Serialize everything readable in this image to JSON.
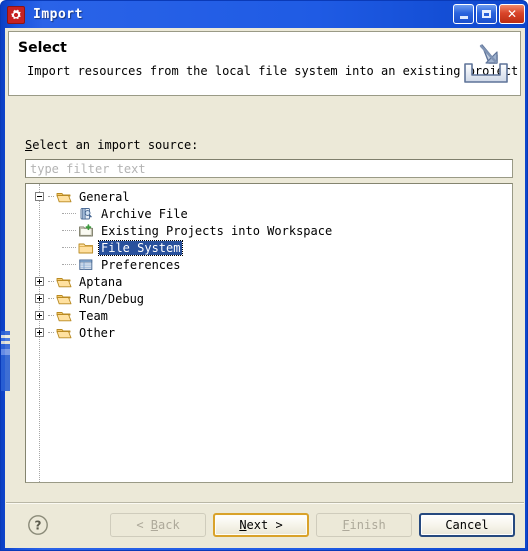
{
  "window": {
    "title": "Import",
    "icon": "gear-icon",
    "controls": {
      "minimize": "Minimize",
      "maximize": "Maximize",
      "close": "Close"
    }
  },
  "header": {
    "title": "Select",
    "description": "Import resources from the local file system into an existing project.",
    "icon": "import-arrow-icon"
  },
  "source": {
    "label_prefix": "S",
    "label_rest": "elect an import source:",
    "filter_value": "",
    "filter_placeholder": "type filter text"
  },
  "tree": {
    "items": [
      {
        "label": "General",
        "level": 0,
        "state": "expanded",
        "icon": "folder-open-icon",
        "selected": false
      },
      {
        "label": "Archive File",
        "level": 1,
        "state": "leaf",
        "icon": "archive-file-icon",
        "selected": false
      },
      {
        "label": "Existing Projects into Workspace",
        "level": 1,
        "state": "leaf",
        "icon": "existing-projects-icon",
        "selected": false
      },
      {
        "label": "File System",
        "level": 1,
        "state": "leaf",
        "icon": "folder-closed-icon",
        "selected": true
      },
      {
        "label": "Preferences",
        "level": 1,
        "state": "leaf",
        "icon": "preferences-icon",
        "selected": false
      },
      {
        "label": "Aptana",
        "level": 0,
        "state": "collapsed",
        "icon": "folder-open-icon",
        "selected": false
      },
      {
        "label": "Run/Debug",
        "level": 0,
        "state": "collapsed",
        "icon": "folder-open-icon",
        "selected": false
      },
      {
        "label": "Team",
        "level": 0,
        "state": "collapsed",
        "icon": "folder-open-icon",
        "selected": false
      },
      {
        "label": "Other",
        "level": 0,
        "state": "collapsed",
        "icon": "folder-open-icon",
        "selected": false
      }
    ]
  },
  "footer": {
    "help_icon": "help-question-icon",
    "back_label": "< Back",
    "back_mnemonic": "B",
    "back_enabled": false,
    "next_label": "Next >",
    "next_mnemonic": "N",
    "next_enabled": true,
    "finish_label": "Finish",
    "finish_mnemonic": "F",
    "finish_enabled": false,
    "cancel_label": "Cancel",
    "cancel_enabled": true
  },
  "colors": {
    "titlebar_blue": "#2A63E8",
    "dialog_bg": "#ECE9D8",
    "selection_blue": "#29519C",
    "default_button_border": "#D9A22A",
    "focus_button_border": "#26497F",
    "close_button_red": "#D9452A"
  }
}
